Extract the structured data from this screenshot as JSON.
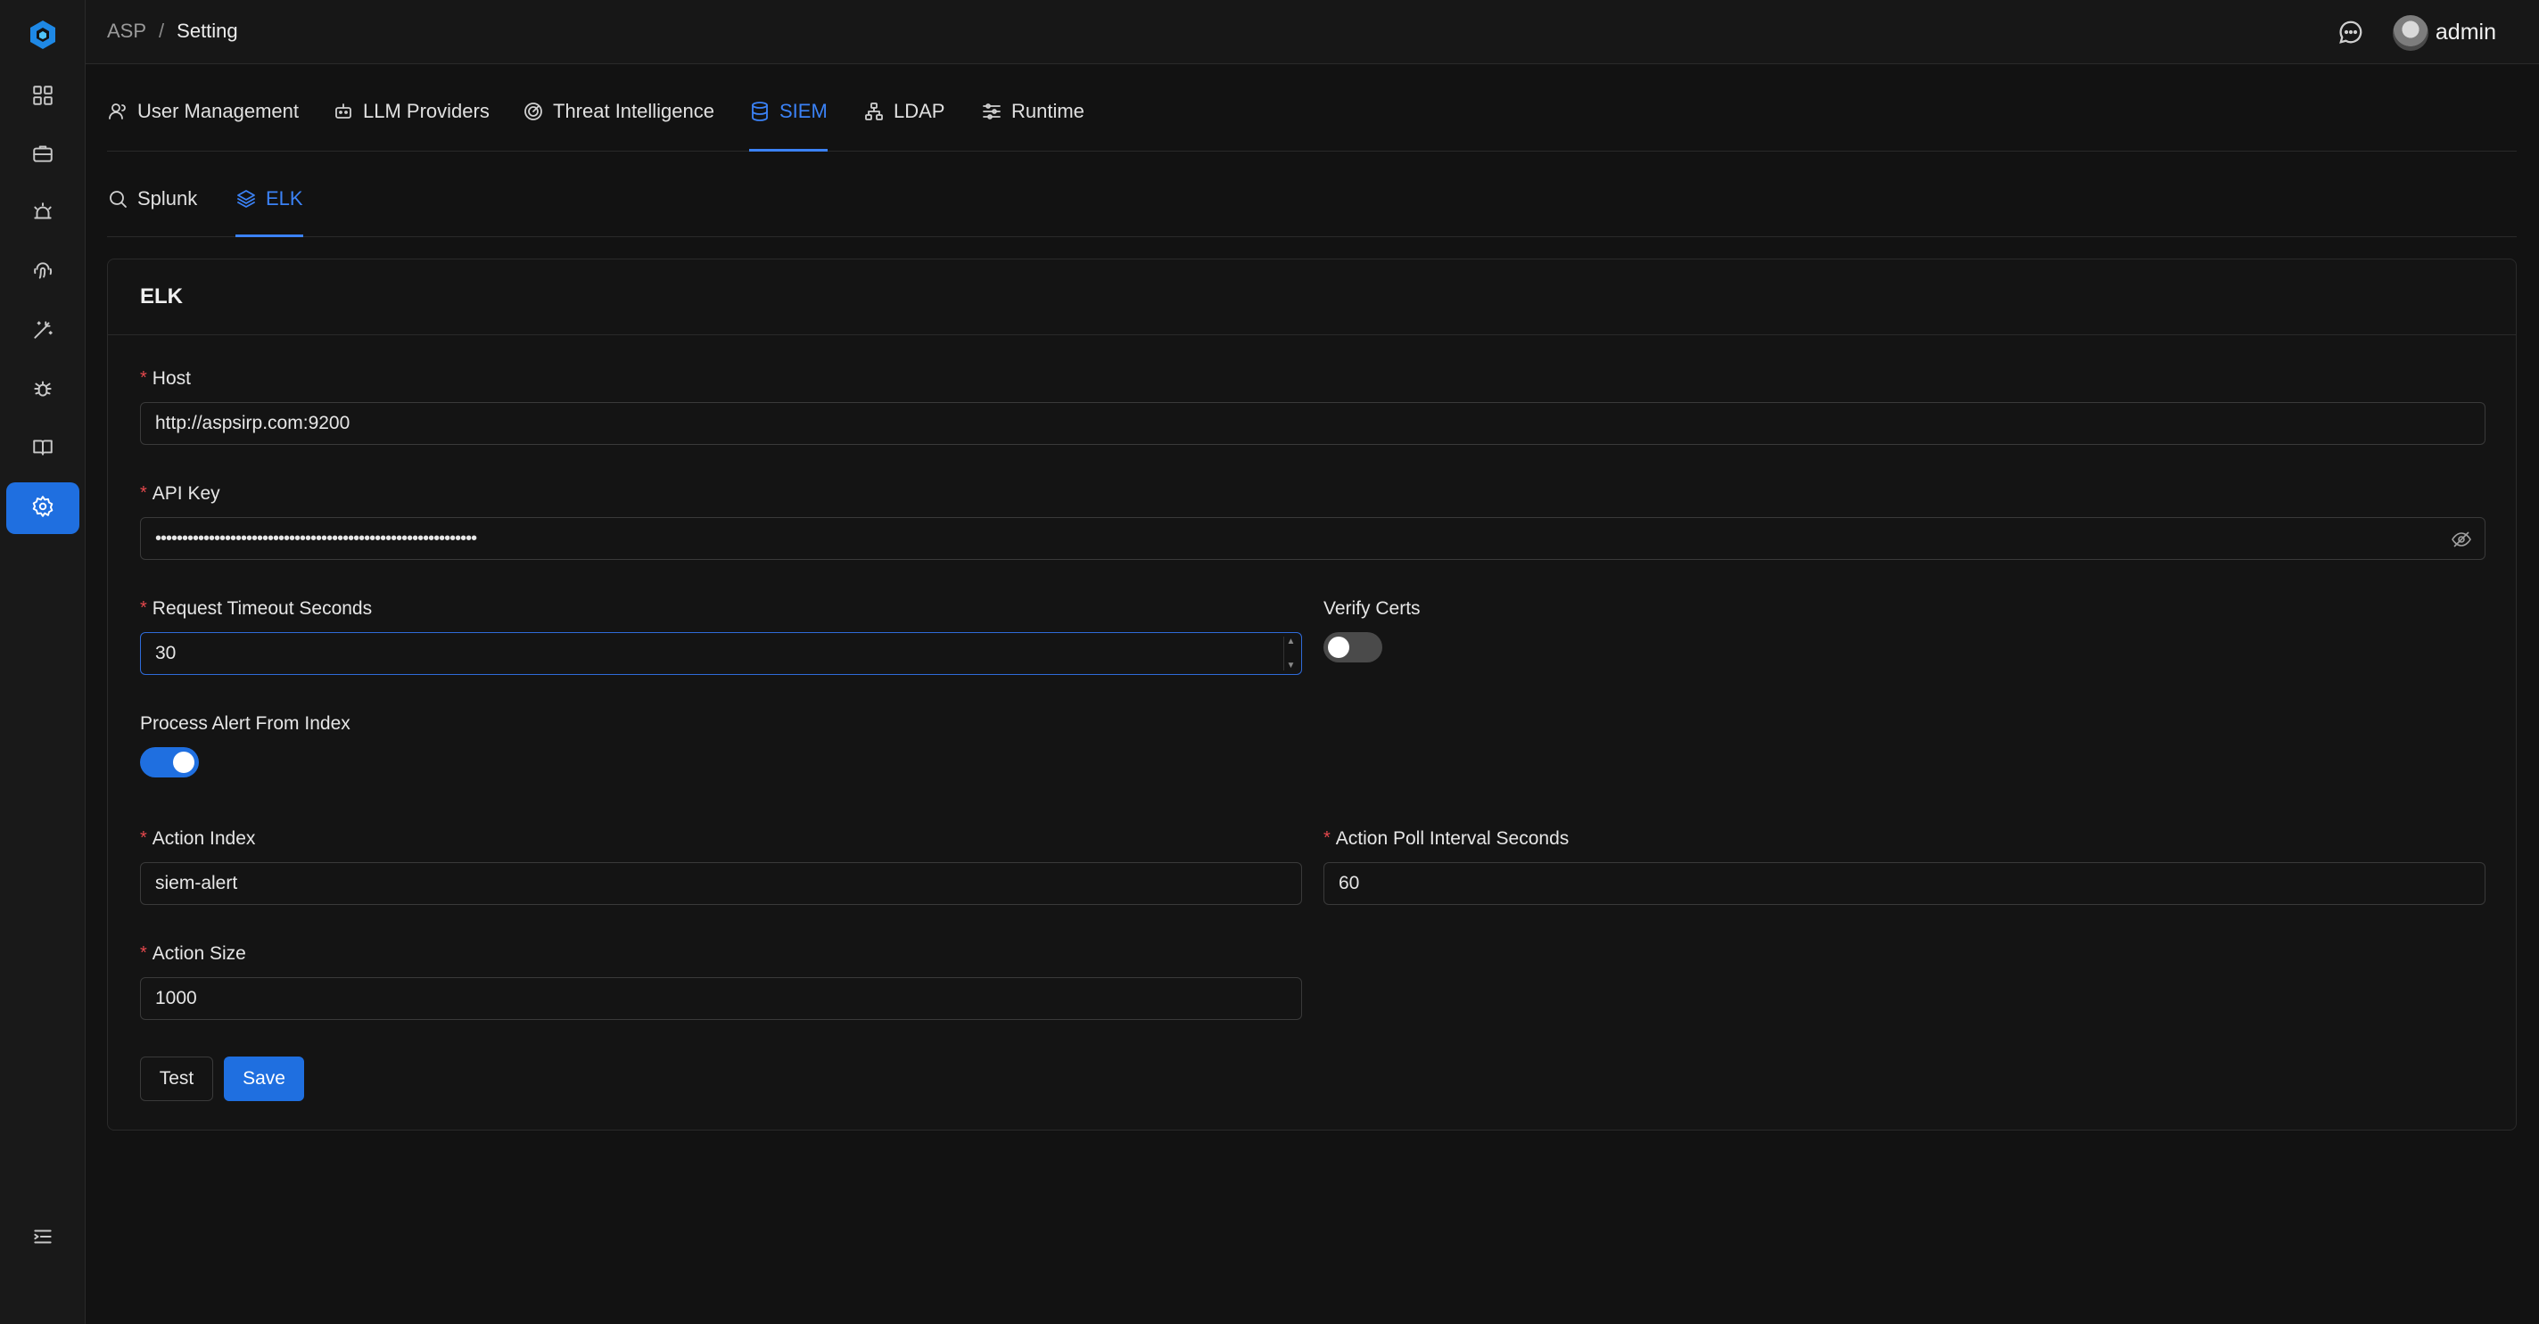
{
  "header": {
    "breadcrumb_root": "ASP",
    "breadcrumb_sep": "/",
    "breadcrumb_current": "Setting",
    "username": "admin"
  },
  "sidebar": {
    "items": [
      {
        "icon": "dashboard-icon"
      },
      {
        "icon": "briefcase-icon"
      },
      {
        "icon": "alarm-icon"
      },
      {
        "icon": "fingerprint-icon"
      },
      {
        "icon": "magic-wand-icon"
      },
      {
        "icon": "bug-icon"
      },
      {
        "icon": "book-icon"
      },
      {
        "icon": "settings-icon",
        "active": true
      }
    ],
    "collapse_icon": "menu-collapse-icon"
  },
  "tabs": [
    {
      "label": "User Management",
      "icon": "user-icon"
    },
    {
      "label": "LLM Providers",
      "icon": "robot-icon"
    },
    {
      "label": "Threat Intelligence",
      "icon": "radar-icon"
    },
    {
      "label": "SIEM",
      "icon": "database-icon",
      "active": true
    },
    {
      "label": "LDAP",
      "icon": "network-icon"
    },
    {
      "label": "Runtime",
      "icon": "sliders-icon"
    }
  ],
  "subtabs": [
    {
      "label": "Splunk",
      "icon": "search-icon"
    },
    {
      "label": "ELK",
      "icon": "layers-icon",
      "active": true
    }
  ],
  "form": {
    "title": "ELK",
    "required_mark": "*",
    "host": {
      "label": "Host",
      "value": "http://aspsirp.com:9200"
    },
    "api_key": {
      "label": "API Key",
      "value": "••••••••••••••••••••••••••••••••••••••••••••••••••••••••••••"
    },
    "timeout": {
      "label": "Request Timeout Seconds",
      "value": "30"
    },
    "verify_certs": {
      "label": "Verify Certs",
      "enabled": false
    },
    "process_alert": {
      "label": "Process Alert From Index",
      "enabled": true
    },
    "action_index": {
      "label": "Action Index",
      "value": "siem-alert"
    },
    "poll_interval": {
      "label": "Action Poll Interval Seconds",
      "value": "60"
    },
    "action_size": {
      "label": "Action Size",
      "value": "1000"
    },
    "test_label": "Test",
    "save_label": "Save"
  },
  "colors": {
    "accent": "#1f6fe0",
    "background": "#121212",
    "required": "#e5484d"
  }
}
